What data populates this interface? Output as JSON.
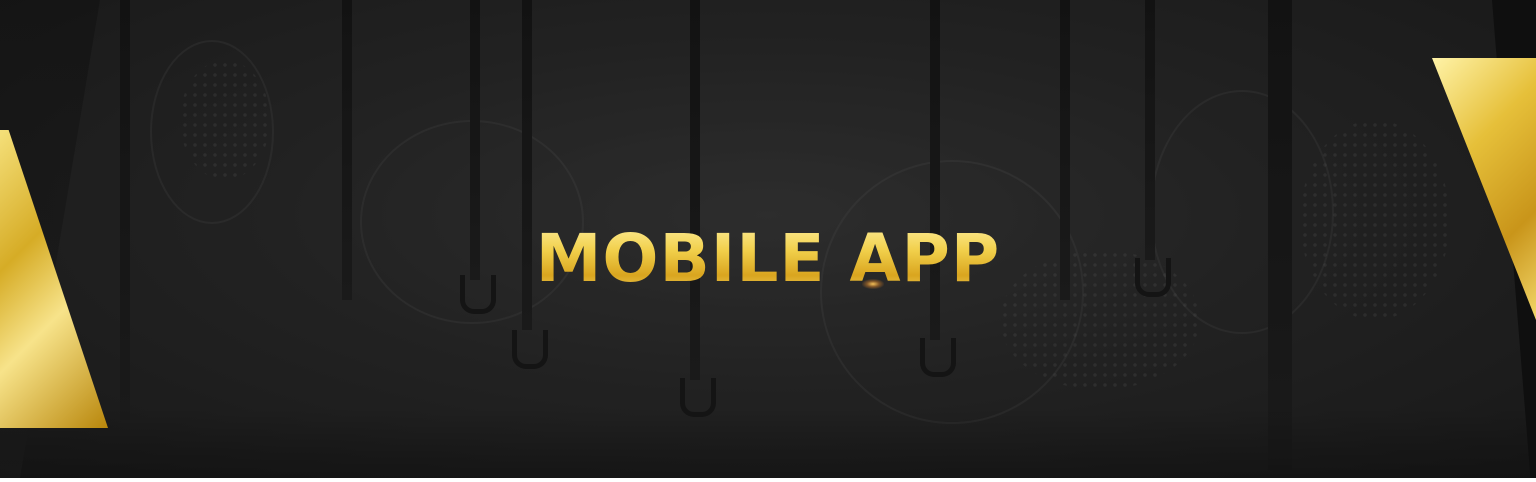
{
  "banner": {
    "title": "MOBILE APP"
  },
  "colors": {
    "gold_light": "#f5e07a",
    "gold_dark": "#d6ac26",
    "background": "#2a2a2a"
  }
}
